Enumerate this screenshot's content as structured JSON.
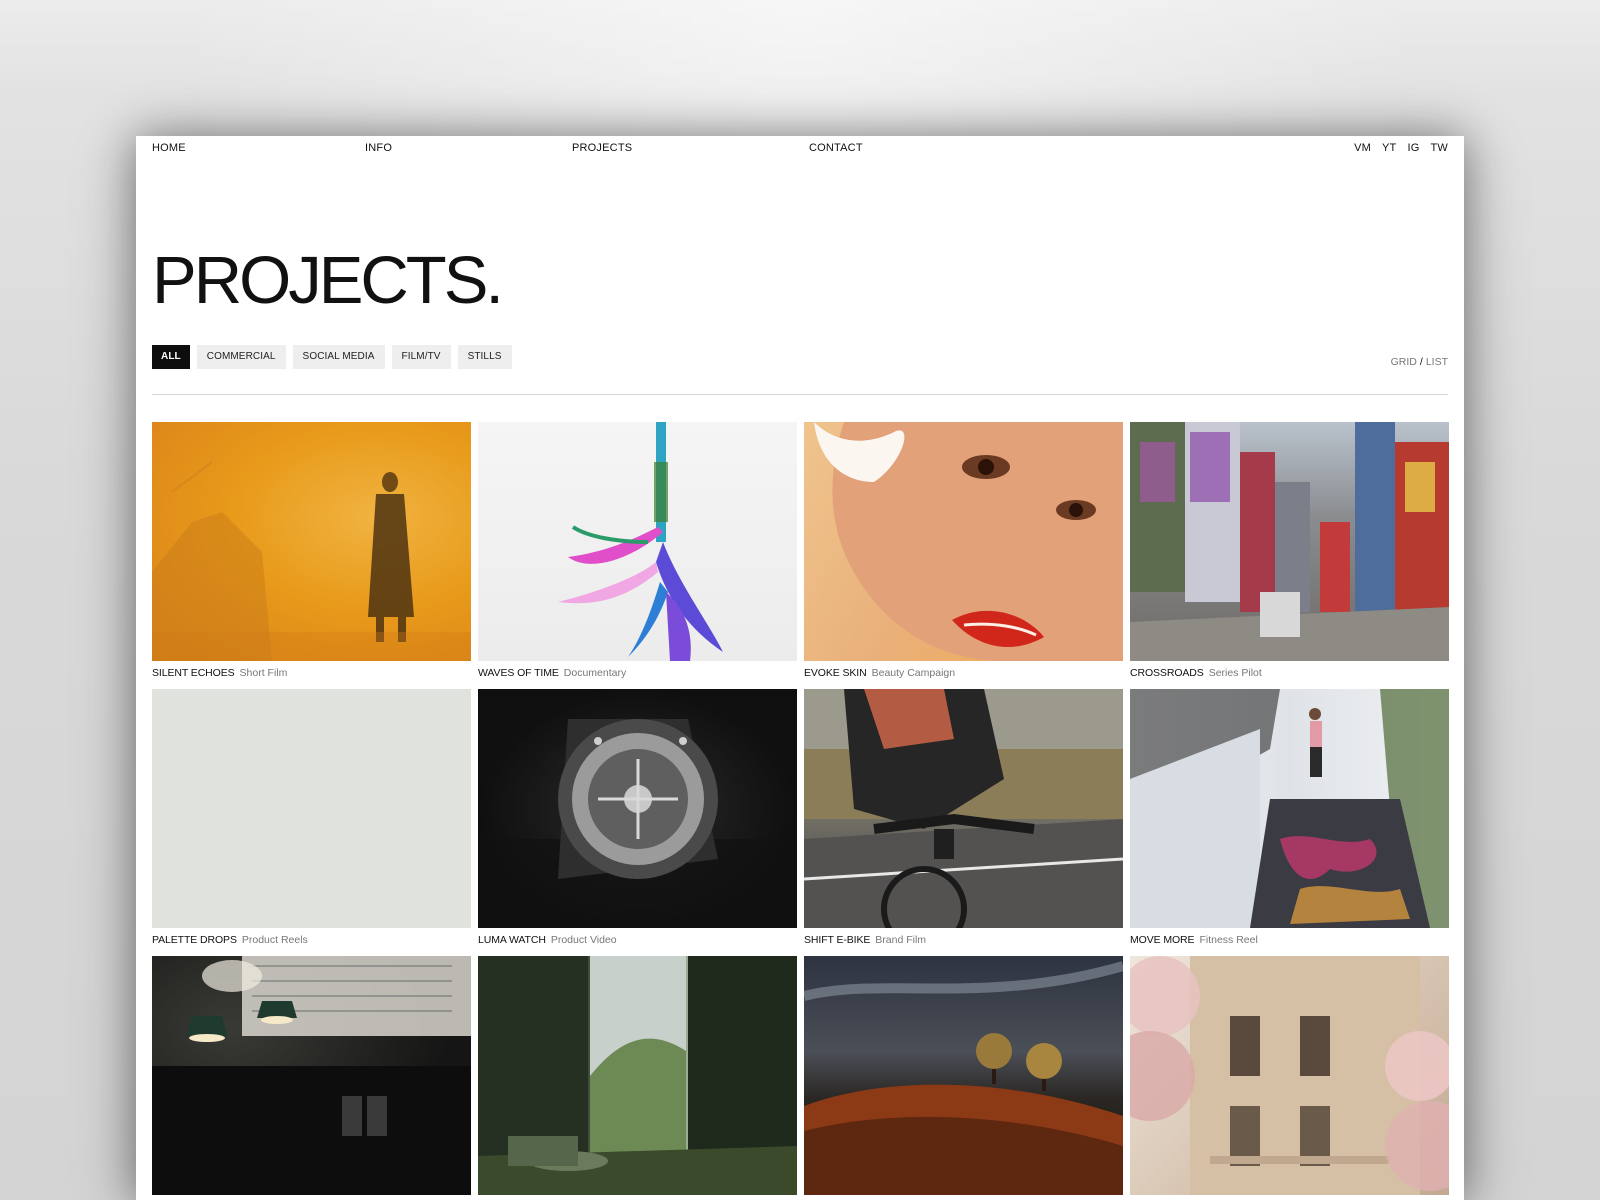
{
  "nav": {
    "home": "HOME",
    "info": "INFO",
    "projects": "PROJECTS",
    "contact": "CONTACT",
    "social": [
      "VM",
      "YT",
      "IG",
      "TW"
    ]
  },
  "page": {
    "title": "PROJECTS."
  },
  "filters": [
    {
      "label": "ALL",
      "active": true
    },
    {
      "label": "COMMERCIAL",
      "active": false
    },
    {
      "label": "SOCIAL MEDIA",
      "active": false
    },
    {
      "label": "FILM/TV",
      "active": false
    },
    {
      "label": "STILLS",
      "active": false
    }
  ],
  "view_toggle": {
    "grid": "GRID",
    "separator": "/",
    "list": "LIST"
  },
  "projects": [
    {
      "title": "SILENT ECHOES",
      "category": "Short Film"
    },
    {
      "title": "WAVES OF TIME",
      "category": "Documentary"
    },
    {
      "title": "EVOKE SKIN",
      "category": "Beauty Campaign"
    },
    {
      "title": "CROSSROADS",
      "category": "Series Pilot"
    },
    {
      "title": "PALETTE DROPS",
      "category": "Product Reels"
    },
    {
      "title": "LUMA WATCH",
      "category": "Product Video"
    },
    {
      "title": "SHIFT E-BIKE",
      "category": "Brand Film"
    },
    {
      "title": "MOVE MORE",
      "category": "Fitness Reel"
    },
    {
      "title": "",
      "category": ""
    },
    {
      "title": "",
      "category": ""
    },
    {
      "title": "",
      "category": ""
    },
    {
      "title": "",
      "category": ""
    }
  ]
}
